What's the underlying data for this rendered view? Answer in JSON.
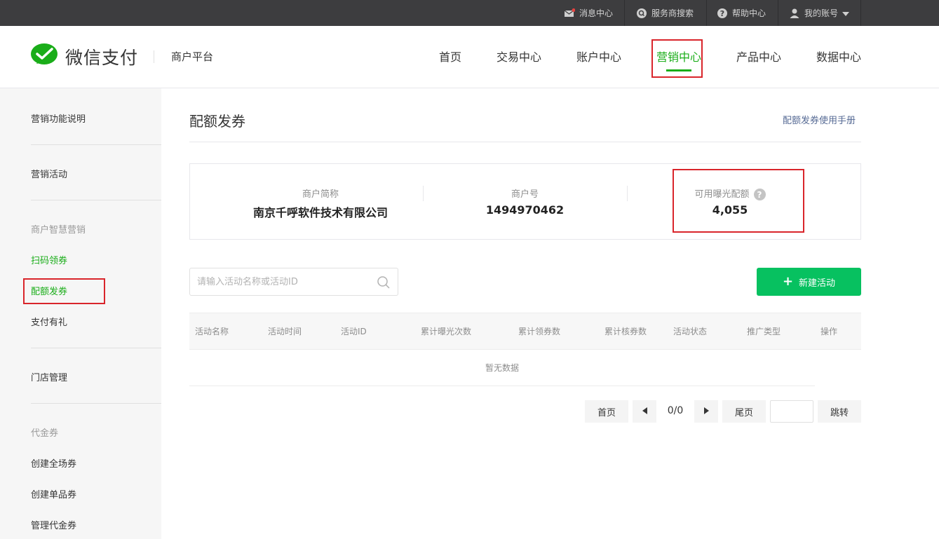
{
  "topbar": {
    "items": [
      {
        "label": "消息中心",
        "icon": "mail-icon"
      },
      {
        "label": "服务商搜索",
        "icon": "search-circle-icon"
      },
      {
        "label": "帮助中心",
        "icon": "help-icon"
      },
      {
        "label": "我的账号",
        "icon": "user-icon"
      }
    ]
  },
  "header": {
    "logo_text": "微信支付",
    "platform": "商户平台",
    "nav": [
      "首页",
      "交易中心",
      "账户中心",
      "营销中心",
      "产品中心",
      "数据中心"
    ],
    "active_nav": "营销中心"
  },
  "sidebar": {
    "items": [
      {
        "label": "营销功能说明",
        "type": "item"
      },
      {
        "label": "营销活动",
        "type": "item"
      },
      {
        "label": "商户智慧营销",
        "type": "group"
      },
      {
        "label": "扫码领券",
        "type": "link"
      },
      {
        "label": "配额发券",
        "type": "link-active"
      },
      {
        "label": "支付有礼",
        "type": "item"
      },
      {
        "label": "门店管理",
        "type": "item"
      },
      {
        "label": "代金券",
        "type": "group"
      },
      {
        "label": "创建全场券",
        "type": "item"
      },
      {
        "label": "创建单品券",
        "type": "item"
      },
      {
        "label": "管理代金券",
        "type": "item"
      }
    ]
  },
  "main": {
    "title": "配额发券",
    "manual_link": "配额发券使用手册",
    "info": {
      "merchant_name_label": "商户简称",
      "merchant_name": "南京千呼软件技术有限公司",
      "merchant_id_label": "商户号",
      "merchant_id": "1494970462",
      "quota_label": "可用曝光配额",
      "quota": "4,055"
    },
    "search_placeholder": "请输入活动名称或活动ID",
    "new_button": "新建活动",
    "table": {
      "columns": [
        "活动名称",
        "活动时间",
        "活动ID",
        "累计曝光次数",
        "累计领券数",
        "累计核券数",
        "活动状态",
        "推广类型",
        "操作"
      ],
      "empty": "暂无数据"
    },
    "pagination": {
      "first": "首页",
      "status": "0/0",
      "last": "尾页",
      "jump": "跳转"
    }
  },
  "colors": {
    "accent": "#1aad19",
    "button": "#07c160",
    "link": "#576b95",
    "highlight_box": "#d9252b",
    "topbar": "#3d3d3f"
  }
}
